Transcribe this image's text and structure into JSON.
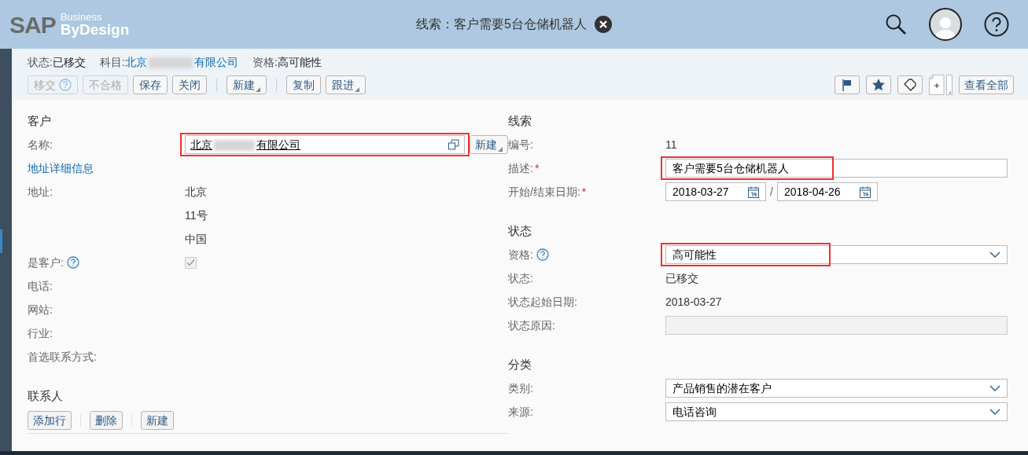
{
  "header": {
    "logo": {
      "brand": "SAP",
      "line_1": "Business",
      "line_2": "ByDesign"
    },
    "title": "线索：客户需要5台仓储机器人"
  },
  "summary": [
    {
      "label": "状态:",
      "value": "已移交",
      "kind": "text"
    },
    {
      "label": "科目:",
      "value_start": "北京",
      "value_end": "有限公司",
      "kind": "link"
    },
    {
      "label": "资格:",
      "value": "高可能性",
      "kind": "text"
    }
  ],
  "toolbar": [
    {
      "kind": "button",
      "label": "移交",
      "disabled": true,
      "help": true,
      "menu": false
    },
    {
      "kind": "button",
      "label": "不合格",
      "disabled": true,
      "help": false,
      "menu": false
    },
    {
      "kind": "button",
      "label": "保存",
      "disabled": false,
      "help": false,
      "menu": false
    },
    {
      "kind": "button",
      "label": "关闭",
      "disabled": false,
      "help": false,
      "menu": false
    },
    {
      "kind": "separator"
    },
    {
      "kind": "button",
      "label": "新建",
      "disabled": false,
      "help": false,
      "menu": true
    },
    {
      "kind": "separator"
    },
    {
      "kind": "button",
      "label": "复制",
      "disabled": false,
      "help": false,
      "menu": false
    },
    {
      "kind": "button",
      "label": "跟进",
      "disabled": false,
      "help": false,
      "menu": true
    }
  ],
  "view_all": "查看全部",
  "left": [
    {
      "title": "客户",
      "rows": [
        {
          "kind": "account",
          "label": "名称:",
          "value_start": "北京",
          "value_end": "有限公司",
          "button": "新建",
          "highlighted": true
        },
        {
          "kind": "link",
          "label": "地址详细信息"
        },
        {
          "kind": "text",
          "label": "地址:",
          "value": "北京"
        },
        {
          "kind": "text",
          "value": "11号"
        },
        {
          "kind": "text",
          "value": "中国"
        },
        {
          "kind": "checkbox",
          "label": "是客户:",
          "help": true,
          "checked": true
        },
        {
          "kind": "text",
          "label": "电话:"
        },
        {
          "kind": "text",
          "label": "网站:"
        },
        {
          "kind": "text",
          "label": "行业:"
        },
        {
          "kind": "text",
          "label": "首选联系方式:"
        }
      ]
    },
    {
      "title": "联系人",
      "buttons": [
        "添加行",
        "删除",
        "新建"
      ]
    }
  ],
  "right": [
    {
      "title": "线索",
      "rows": [
        {
          "kind": "text",
          "label": "编号:",
          "value": "11"
        },
        {
          "kind": "input",
          "label": "描述:",
          "required_mark": "*",
          "value": "客户需要5台仓储机器人",
          "highlighted": true
        },
        {
          "kind": "dates",
          "label": "开始/结束日期:",
          "required_mark": "*",
          "start": "2018-03-27",
          "separator": "/",
          "end": "2018-04-26"
        }
      ]
    },
    {
      "title": "状态",
      "rows": [
        {
          "kind": "select",
          "label": "资格:",
          "help": true,
          "value": "高可能性",
          "highlighted": true
        },
        {
          "kind": "text",
          "label": "状态:",
          "value": "已移交"
        },
        {
          "kind": "text",
          "label": "状态起始日期:",
          "value": "2018-03-27"
        },
        {
          "kind": "readonly",
          "label": "状态原因:"
        }
      ]
    },
    {
      "title": "分类",
      "rows": [
        {
          "kind": "select",
          "label": "类别:",
          "value": "产品销售的潜在客户",
          "highlighted": false
        },
        {
          "kind": "select",
          "label": "来源:",
          "value": "电话咨询",
          "highlighted": false
        }
      ]
    }
  ]
}
